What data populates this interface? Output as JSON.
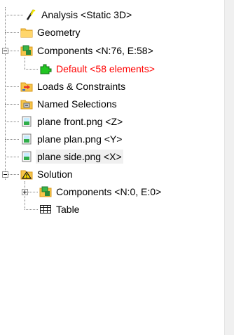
{
  "tree": {
    "items": [
      {
        "label": "Analysis <Static 3D>",
        "icon": "analysis-wand-icon",
        "color": "#000000"
      },
      {
        "label": "Geometry",
        "icon": "folder-icon",
        "color": "#000000"
      },
      {
        "label": "Components <N:76, E:58>",
        "icon": "components-cube-icon",
        "color": "#000000",
        "expanded": true
      },
      {
        "label": "Default <58 elements>",
        "icon": "puzzle-piece-icon",
        "color": "#ff0000"
      },
      {
        "label": "Loads & Constraints",
        "icon": "loads-constraints-icon",
        "color": "#000000"
      },
      {
        "label": "Named Selections",
        "icon": "named-selections-icon",
        "color": "#000000"
      },
      {
        "label": "plane front.png <Z>",
        "icon": "image-plane-icon",
        "color": "#000000"
      },
      {
        "label": "plane plan.png <Y>",
        "icon": "image-plane-icon",
        "color": "#000000"
      },
      {
        "label": "plane side.png <X>",
        "icon": "image-plane-icon",
        "color": "#000000",
        "selected": true
      },
      {
        "label": "Solution",
        "icon": "solution-warning-icon",
        "color": "#000000",
        "expanded": true
      },
      {
        "label": "Components <N:0, E:0>",
        "icon": "components-cube-icon",
        "color": "#000000",
        "expanded": false
      },
      {
        "label": "Table",
        "icon": "table-grid-icon",
        "color": "#000000"
      }
    ]
  },
  "colors": {
    "folder": "#f6c54b",
    "puzzle": "#22c522",
    "accent_red": "#ff0000",
    "selection_bg": "#f0f0f0"
  }
}
